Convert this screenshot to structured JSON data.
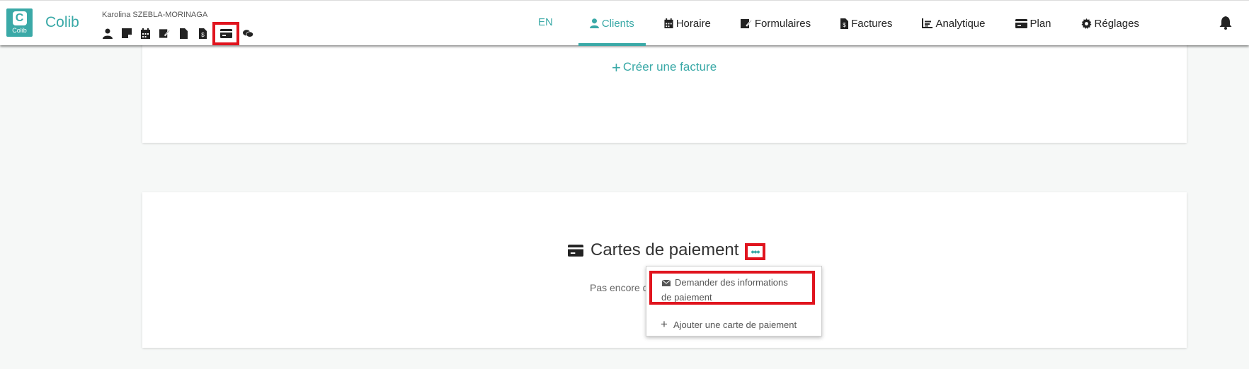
{
  "app": {
    "brand": "Colib",
    "logo_text": "Colib"
  },
  "client": {
    "name": "Karolina SZEBLA-MORINAGA",
    "icons": [
      "user-icon",
      "note-icon",
      "calendar-icon",
      "form-edit-icon",
      "file-icon",
      "invoice-icon",
      "credit-card-icon",
      "chat-icon"
    ],
    "selected_icon": "credit-card-icon"
  },
  "nav": {
    "lang": "EN",
    "items": [
      {
        "label": "Clients",
        "icon": "user-icon",
        "active": true
      },
      {
        "label": "Horaire",
        "icon": "calendar-icon"
      },
      {
        "label": "Formulaires",
        "icon": "form-edit-icon"
      },
      {
        "label": "Factures",
        "icon": "invoice-icon"
      },
      {
        "label": "Analytique",
        "icon": "chart-icon"
      },
      {
        "label": "Plan",
        "icon": "credit-card-icon"
      },
      {
        "label": "Réglages",
        "icon": "gear-icon"
      }
    ],
    "bell_icon": "bell-icon"
  },
  "invoice_section": {
    "create_label": "Créer une facture"
  },
  "payment_section": {
    "title": "Cartes de paiement",
    "more_label": "•••",
    "empty_text": "Pas encore d"
  },
  "dropdown": {
    "request_label_line1": "Demander des informations",
    "request_label_line2": "de paiement",
    "add_label": "Ajouter une carte de paiement"
  },
  "colors": {
    "accent": "#3aa9a7",
    "highlight": "#e0141e"
  }
}
